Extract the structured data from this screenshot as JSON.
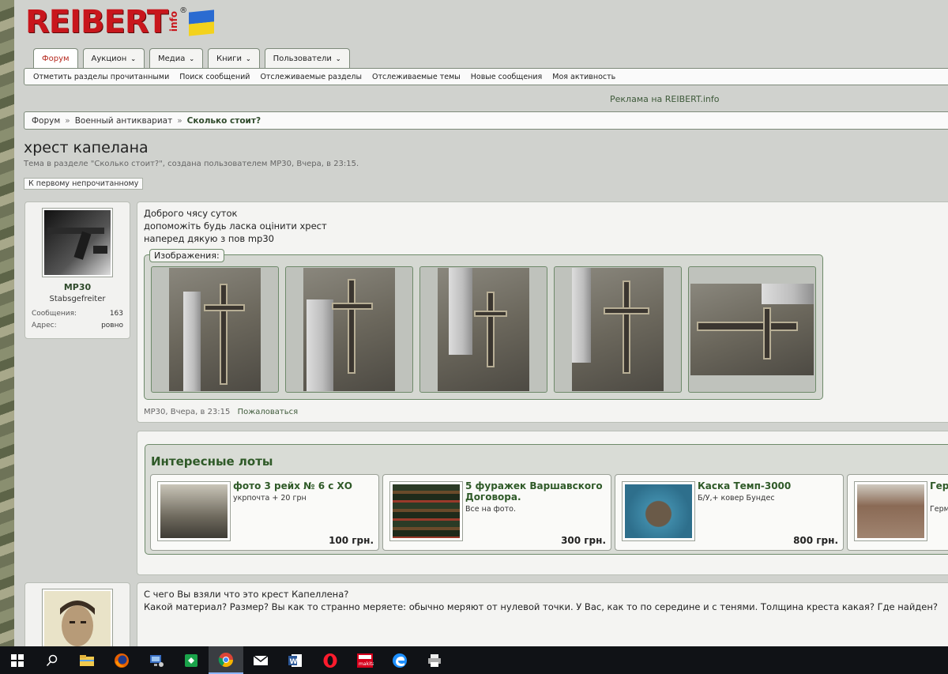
{
  "site": {
    "logo_text": "REIBERT",
    "logo_suffix": "info",
    "logo_reg": "®"
  },
  "tabs": [
    {
      "label": "Форум",
      "dropdown": false,
      "active": true
    },
    {
      "label": "Аукцион",
      "dropdown": true,
      "active": false
    },
    {
      "label": "Медиа",
      "dropdown": true,
      "active": false
    },
    {
      "label": "Книги",
      "dropdown": true,
      "active": false
    },
    {
      "label": "Пользователи",
      "dropdown": true,
      "active": false
    }
  ],
  "subnav": [
    "Отметить разделы прочитанными",
    "Поиск сообщений",
    "Отслеживаемые разделы",
    "Отслеживаемые темы",
    "Новые сообщения",
    "Моя активность"
  ],
  "ad_link": "Реклама на REIBERT.info",
  "breadcrumb": {
    "items": [
      "Форум",
      "Военный антиквариат"
    ],
    "current": "Сколько стоит?",
    "separator": "»"
  },
  "thread": {
    "title": "хрест капелана",
    "meta": "Тема в разделе \"Сколько стоит?\", создана пользователем МР30, Вчера, в 23:15.",
    "unread_button": "К первому непрочитанному"
  },
  "post1": {
    "user": {
      "name": "МР30",
      "rank": "Stabsgefreiter",
      "messages_label": "Сообщения:",
      "messages": "163",
      "address_label": "Адрес:",
      "address": "ровно"
    },
    "lines": [
      "Доброго чясу суток",
      "допоможіть будь ласка оцінити хрест",
      "наперед дякую з пов mp30"
    ],
    "attachments_label": "Изображения:",
    "attachments_count": 5,
    "footer": {
      "author": "МР30",
      "time": ", Вчера, в 23:15",
      "report": "Пожаловаться"
    }
  },
  "lots": {
    "title": "Интересные лоты",
    "items": [
      {
        "name": "фото 3 рейх № 6 с ХО",
        "desc": "укрпочта + 20 грн",
        "price": "100 грн."
      },
      {
        "name": "5 фуражек Варшавского Договора.",
        "desc": "Все на фото.",
        "price": "300 грн."
      },
      {
        "name": "Каска Темп-3000",
        "desc": "Б/У,+ ковер Бундес",
        "price": "800 грн."
      },
      {
        "name": "Гер бро",
        "desc": "Герм пери",
        "price": ""
      }
    ]
  },
  "post2": {
    "lines": [
      "С чего Вы взяли что это крест Капеллена?",
      "Какой материал? Размер? Вы как то странно меряете: обычно меряют от нулевой точки. У Вас, как то по середине и с тенями. Толщина креста какая? Где найден?"
    ]
  },
  "taskbar": {
    "icons": [
      "windows-start-icon",
      "search-icon",
      "file-explorer-icon",
      "firefox-icon",
      "system-config-icon",
      "media-app-icon",
      "chrome-icon",
      "mail-icon",
      "word-icon",
      "opera-icon",
      "makita-icon",
      "edge-icon",
      "printer-icon"
    ]
  }
}
